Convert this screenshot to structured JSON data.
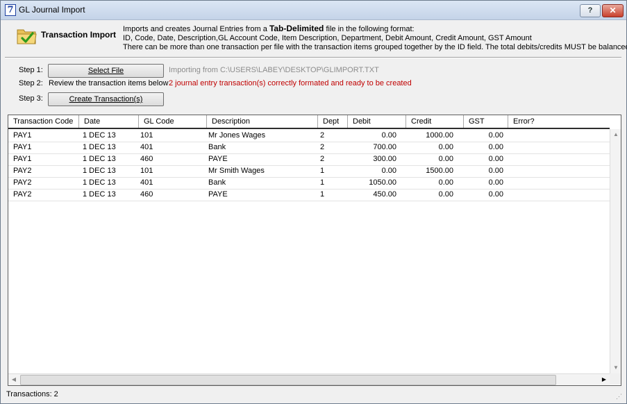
{
  "window": {
    "title": "GL Journal Import",
    "help_label": "?",
    "close_label": "✕"
  },
  "header": {
    "title": "Transaction Import",
    "desc_line1_pre": "Imports and creates Journal Entries from a ",
    "desc_line1_bold": "Tab-Delimited",
    "desc_line1_post": " file in the following format:",
    "desc_line2": "ID, Code, Date, Description,GL Account Code, Item Description, Department, Debit Amount, Credit Amount, GST Amount",
    "desc_line3": "There can be more than one transaction per file with the transaction items grouped together by the ID field. The total debits/credits MUST be balanced"
  },
  "steps": {
    "step1_label": "Step 1:",
    "select_file_label": "Select File",
    "import_path": "Importing from C:\\USERS\\LABEY\\DESKTOP\\GLIMPORT.TXT",
    "step2_label": "Step 2:",
    "review_text": "Review the transaction items below",
    "status_text": "2 journal entry transaction(s) correctly formated and ready to be created",
    "step3_label": "Step 3:",
    "create_label": "Create Transaction(s)"
  },
  "grid": {
    "columns": [
      "Transaction Code",
      "Date",
      "GL Code",
      "Description",
      "Dept",
      "Debit",
      "Credit",
      "GST",
      "Error?"
    ],
    "rows": [
      [
        "PAY1",
        "1 DEC 13",
        "101",
        "Mr Jones Wages",
        "2",
        "0.00",
        "1000.00",
        "0.00",
        ""
      ],
      [
        "PAY1",
        "1 DEC 13",
        "401",
        "Bank",
        "2",
        "700.00",
        "0.00",
        "0.00",
        ""
      ],
      [
        "PAY1",
        "1 DEC 13",
        "460",
        "PAYE",
        "2",
        "300.00",
        "0.00",
        "0.00",
        ""
      ],
      [
        "PAY2",
        "1 DEC 13",
        "101",
        "Mr Smith Wages",
        "1",
        "0.00",
        "1500.00",
        "0.00",
        ""
      ],
      [
        "PAY2",
        "1 DEC 13",
        "401",
        "Bank",
        "1",
        "1050.00",
        "0.00",
        "0.00",
        ""
      ],
      [
        "PAY2",
        "1 DEC 13",
        "460",
        "PAYE",
        "1",
        "450.00",
        "0.00",
        "0.00",
        ""
      ]
    ]
  },
  "status_bar": {
    "text": "Transactions: 2"
  },
  "icons": {
    "header_icon": "folder-check-icon",
    "app_icon": "app-logo-icon"
  }
}
